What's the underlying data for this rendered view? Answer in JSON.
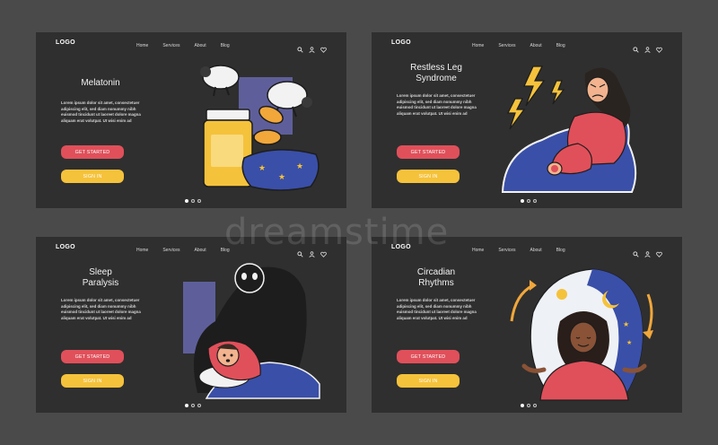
{
  "nav": {
    "logo": "LOGO",
    "links": [
      "Home",
      "Services",
      "About",
      "Blog"
    ]
  },
  "cards": [
    {
      "title_line1": "Melatonin",
      "body": "Lorem ipsum dolor sit amet, consectetuer adipiscing elit, sed diam nonummy nibh euismod tincidunt ut laoreet dolore magna aliquam erat volutpat. Ut wisi enim ad",
      "cta": "GET STARTED",
      "signin": "SIGN IN"
    },
    {
      "title_line1": "Restless Leg",
      "title_line2": "Syndrome",
      "body": "Lorem ipsum dolor sit amet, consectetuer adipiscing elit, sed diam nonummy nibh euismod tincidunt ut laoreet dolore magna aliquam erat volutpat. Ut wisi enim ad",
      "cta": "GET STARTED",
      "signin": "SIGN IN"
    },
    {
      "title_line1": "Sleep",
      "title_line2": "Paralysis",
      "body": "Lorem ipsum dolor sit amet, consectetuer adipiscing elit, sed diam nonummy nibh euismod tincidunt ut laoreet dolore magna aliquam erat volutpat. Ut wisi enim ad",
      "cta": "GET STARTED",
      "signin": "SIGN IN"
    },
    {
      "title_line1": "Circadian",
      "title_line2": "Rhythms",
      "body": "Lorem ipsum dolor sit amet, consectetuer adipiscing elit, sed diam nonummy nibh euismod tincidunt ut laoreet dolore magna aliquam erat volutpat. Ut wisi enim ad",
      "cta": "GET STARTED",
      "signin": "SIGN IN"
    }
  ],
  "pager": {
    "pages": 3,
    "active": 1
  },
  "watermark": "dreamstime",
  "icons": [
    "search-icon",
    "user-icon",
    "heart-icon"
  ],
  "colors": {
    "background": "#4a4a4a",
    "card": "#2f2f2f",
    "primary_button": "#e0505a",
    "secondary_button": "#f5c23b",
    "accent_blue": "#3a4fa8"
  }
}
